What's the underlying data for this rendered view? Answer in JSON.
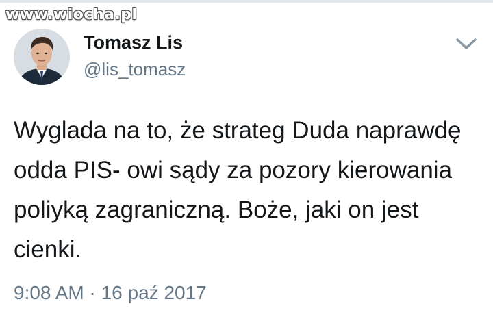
{
  "watermark": {
    "text": "www.wiocha.pl"
  },
  "tweet": {
    "author_name": "Tomasz Lis",
    "author_handle": "@lis_tomasz",
    "text": "Wyglada na to, że strateg Duda naprawdę odda PIS- owi sądy za pozory kierowania poliyką zagraniczną. Boże, jaki on jest cienki.",
    "timestamp": "9:08 AM · 16 paź 2017"
  },
  "icons": {
    "menu": "chevron-down-icon"
  },
  "colors": {
    "text_primary": "#14171a",
    "text_secondary": "#657786",
    "chevron": "#8899a6"
  }
}
